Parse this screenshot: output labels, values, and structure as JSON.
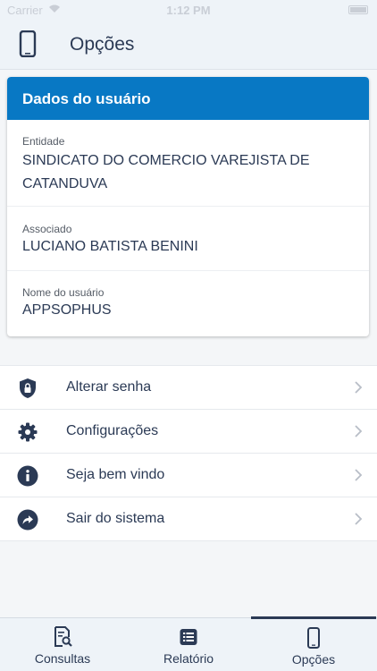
{
  "status_bar": {
    "carrier": "Carrier",
    "time": "1:12 PM"
  },
  "header": {
    "title": "Opções",
    "icon": "phone-icon"
  },
  "user_card": {
    "title": "Dados do usuário",
    "fields": [
      {
        "label": "Entidade",
        "value": "SINDICATO DO COMERCIO VAREJISTA DE CATANDUVA"
      },
      {
        "label": "Associado",
        "value": "LUCIANO BATISTA BENINI"
      },
      {
        "label": "Nome do usuário",
        "value": "APPSOPHUS"
      }
    ]
  },
  "menu": {
    "items": [
      {
        "label": "Alterar senha",
        "icon": "shield-lock-icon"
      },
      {
        "label": "Configurações",
        "icon": "gear-icon"
      },
      {
        "label": "Seja bem vindo",
        "icon": "info-icon"
      },
      {
        "label": "Sair do sistema",
        "icon": "share-arrow-icon"
      }
    ]
  },
  "tabs": [
    {
      "label": "Consultas",
      "icon": "document-search-icon",
      "active": false
    },
    {
      "label": "Relatório",
      "icon": "list-icon",
      "active": false
    },
    {
      "label": "Opções",
      "icon": "phone-icon",
      "active": true
    }
  ],
  "colors": {
    "accent": "#0878c4",
    "text": "#2b3a55",
    "bar_bg": "#eef3f8"
  }
}
